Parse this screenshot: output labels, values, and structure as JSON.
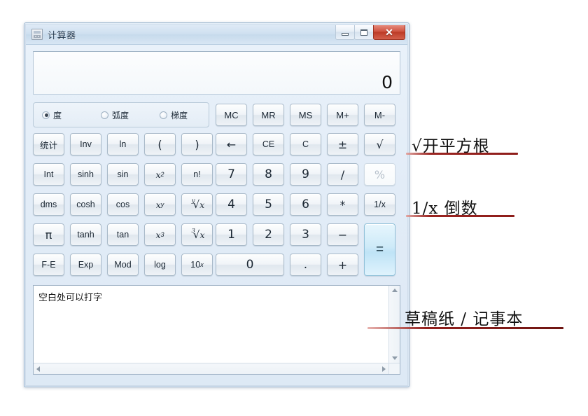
{
  "window": {
    "title": "计算器",
    "icon": "calculator-icon",
    "controls": {
      "minimize": "minimize-icon",
      "maximize": "maximize-icon",
      "close": "✕"
    }
  },
  "display": {
    "value": "0"
  },
  "angle_modes": [
    {
      "label": "度",
      "selected": true
    },
    {
      "label": "弧度",
      "selected": false
    },
    {
      "label": "梯度",
      "selected": false
    }
  ],
  "memory_buttons": [
    "MC",
    "MR",
    "MS",
    "M+",
    "M-"
  ],
  "keypad": {
    "row1": [
      "统计",
      "Inv",
      "ln",
      "(",
      ")",
      "←",
      "CE",
      "C",
      "±",
      "√"
    ],
    "row2": [
      "Int",
      "sinh",
      "sin",
      "x²",
      "n!",
      "7",
      "8",
      "9",
      "/",
      "%"
    ],
    "row3": [
      "dms",
      "cosh",
      "cos",
      "xʸ",
      "ʸ√x",
      "4",
      "5",
      "6",
      "*",
      "1/x"
    ],
    "row4": [
      "π",
      "tanh",
      "tan",
      "x³",
      "³√x",
      "1",
      "2",
      "3",
      "−"
    ],
    "row5": [
      "F-E",
      "Exp",
      "Mod",
      "log",
      "10ˣ",
      "0",
      ".",
      "+"
    ],
    "equals": "=",
    "disabled": [
      "%"
    ]
  },
  "notepad": {
    "text": "空白处可以打字"
  },
  "annotations": [
    {
      "text": "√开平方根",
      "target": "sqrt-button"
    },
    {
      "text": "1/x 倒数",
      "target": "reciprocal-button"
    },
    {
      "text": "草稿纸 / 记事本",
      "target": "notepad"
    }
  ],
  "colors": {
    "accent": "#bfe3f6",
    "close": "#bc3b27",
    "annotation_line": "#8e1d1a"
  }
}
